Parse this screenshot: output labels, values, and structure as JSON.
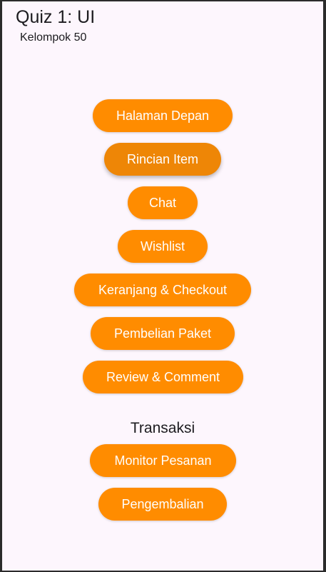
{
  "app": {
    "title": "Quiz 1: UI",
    "subtitle": "Kelompok 50"
  },
  "menu": {
    "items": [
      {
        "label": "Halaman Depan"
      },
      {
        "label": "Rincian Item",
        "state": "pressed"
      },
      {
        "label": "Chat"
      },
      {
        "label": "Wishlist"
      },
      {
        "label": "Keranjang & Checkout"
      },
      {
        "label": "Pembelian Paket"
      },
      {
        "label": "Review & Comment"
      }
    ]
  },
  "transaksi": {
    "heading": "Transaksi",
    "items": [
      {
        "label": "Monitor Pesanan"
      },
      {
        "label": "Pengembalian"
      }
    ]
  },
  "colors": {
    "accent": "#ff8c00",
    "background": "#fdf6fd",
    "text": "#1c1b1f"
  }
}
